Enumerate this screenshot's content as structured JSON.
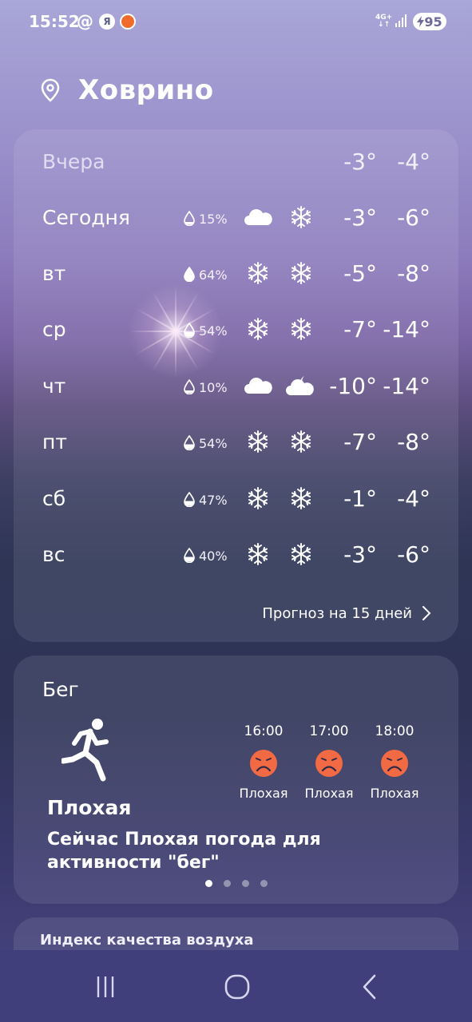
{
  "status_bar": {
    "time": "15:52",
    "notification_icons": [
      "at-icon",
      "yandex-icon",
      "orange-app-icon"
    ],
    "network": "4G+",
    "battery": "95"
  },
  "location": {
    "city": "Ховрино"
  },
  "forecast": {
    "rows": [
      {
        "day": "Вчера",
        "hi": "-3°",
        "lo": "-4°"
      },
      {
        "day": "Сегодня",
        "precip": "15%",
        "icons": [
          "cloud-icon",
          "snowflake-icon"
        ],
        "hi": "-3°",
        "lo": "-6°"
      },
      {
        "day": "вт",
        "precip": "64%",
        "icons": [
          "snowflake-icon",
          "snowflake-icon"
        ],
        "hi": "-5°",
        "lo": "-8°"
      },
      {
        "day": "ср",
        "precip": "54%",
        "icons": [
          "snowflake-icon",
          "snowflake-icon"
        ],
        "hi": "-7°",
        "lo": "-14°"
      },
      {
        "day": "чт",
        "precip": "10%",
        "icons": [
          "cloud-icon",
          "cloud-moon-icon"
        ],
        "hi": "-10°",
        "lo": "-14°"
      },
      {
        "day": "пт",
        "precip": "54%",
        "icons": [
          "snowflake-icon",
          "snowflake-icon"
        ],
        "hi": "-7°",
        "lo": "-8°"
      },
      {
        "day": "сб",
        "precip": "47%",
        "icons": [
          "snowflake-icon",
          "snowflake-icon"
        ],
        "hi": "-1°",
        "lo": "-4°"
      },
      {
        "day": "вс",
        "precip": "40%",
        "icons": [
          "snowflake-icon",
          "snowflake-icon"
        ],
        "hi": "-3°",
        "lo": "-6°"
      }
    ],
    "more_label": "Прогноз на 15 дней"
  },
  "running": {
    "title": "Бег",
    "hours": [
      {
        "time": "16:00",
        "status": "Плохая"
      },
      {
        "time": "17:00",
        "status": "Плохая"
      },
      {
        "time": "18:00",
        "status": "Плохая"
      }
    ],
    "status": "Плохая",
    "description": "Сейчас Плохая погода для активности \"бег\"",
    "page_indicator": {
      "count": 4,
      "active": 1
    }
  },
  "air_quality": {
    "title": "Индекс качества воздуха"
  },
  "colors": {
    "face_bad": "#f26a43",
    "nav_bar": "#403f7b"
  }
}
